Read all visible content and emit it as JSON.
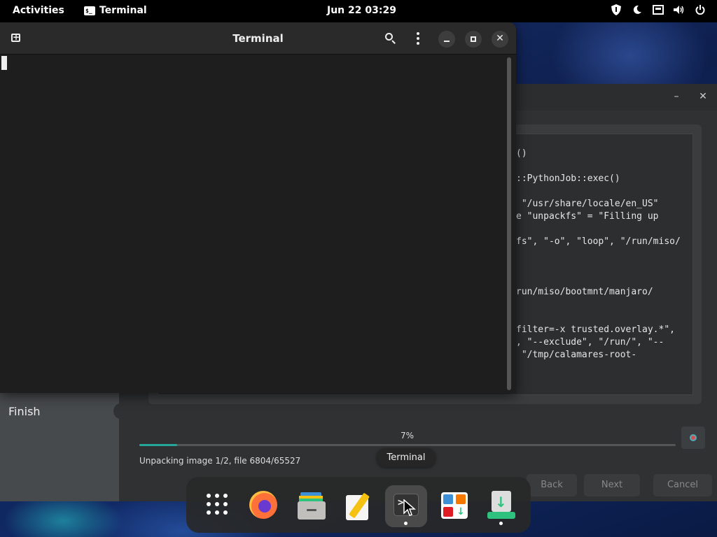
{
  "topbar": {
    "activities": "Activities",
    "app_name": "Terminal",
    "clock": "Jun 22  03:29",
    "tray_icons": [
      "shield-icon",
      "night-light-icon",
      "network-icon",
      "volume-icon",
      "power-icon"
    ]
  },
  "terminal": {
    "title": "Terminal"
  },
  "installer": {
    "log_lines": [
      "()",
      "::PythonJob::exec()",
      " \"/usr/share/locale/en_US\"",
      "e \"unpackfs\" = \"Filling up",
      "fs\", \"-o\", \"loop\", \"/run/miso/",
      "run/miso/bootmnt/manjaro/",
      "filter=-x trusted.overlay.*\",",
      ", \"--exclude\", \"/run/\", \"--",
      " \"/tmp/calamares-root-"
    ],
    "sidebar_step": "Finish",
    "progress_label": "7%",
    "progress_fraction": 0.07,
    "status": "Unpacking image 1/2, file 6804/65527",
    "buttons": {
      "back": "Back",
      "next": "Next",
      "cancel": "Cancel"
    }
  },
  "tooltip": "Terminal",
  "dock": {
    "items": [
      "app-grid-icon",
      "firefox-icon",
      "files-icon",
      "text-editor-icon",
      "terminal-icon",
      "software-icon",
      "installer-icon"
    ],
    "active": "terminal-icon"
  },
  "colors": {
    "accent": "#26a69a",
    "topbar": "#000000",
    "terminal_bg": "#1e1e1e"
  }
}
